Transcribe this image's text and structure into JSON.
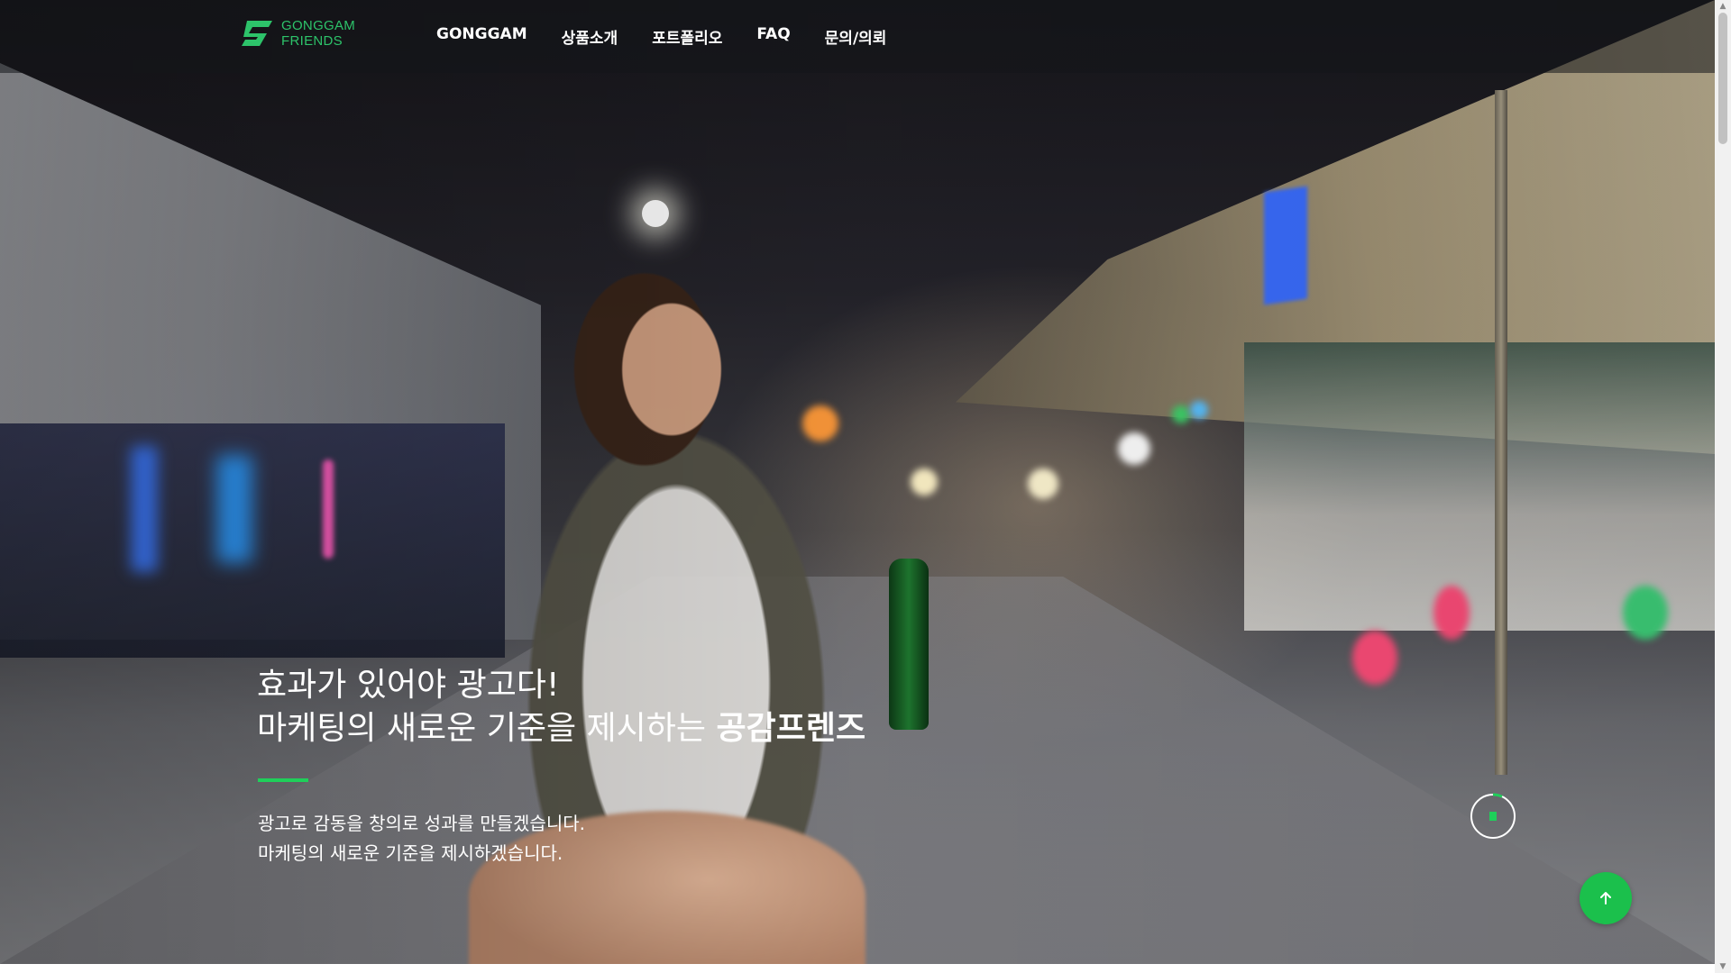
{
  "brand": {
    "line1": "GONGGAM",
    "line2": "FRIENDS",
    "accent_color": "#2dc36a"
  },
  "nav": {
    "items": [
      {
        "label": "GONGGAM"
      },
      {
        "label": "상품소개"
      },
      {
        "label": "포트폴리오"
      },
      {
        "label": "FAQ"
      },
      {
        "label": "문의/의뢰"
      }
    ]
  },
  "hero": {
    "headline_line1": "효과가 있어야 광고다!",
    "headline_line2_prefix": "마케팅의 새로운 기준을 제시하는 ",
    "headline_line2_bold": "공감프렌즈",
    "sub_line1": "광고로 감동을 창의로 성과를 만들겠습니다.",
    "sub_line2": "마케팅의 새로운 기준을 제시하겠습니다.",
    "accent_bar_color": "#1fcf5a"
  },
  "controls": {
    "video_toggle_icon": "pause-ring-icon",
    "to_top_icon": "arrow-up-icon",
    "to_top_color": "#1bc04c"
  },
  "scrollbar": {
    "up_icon": "triangle-up-icon",
    "down_icon": "triangle-down-icon"
  }
}
